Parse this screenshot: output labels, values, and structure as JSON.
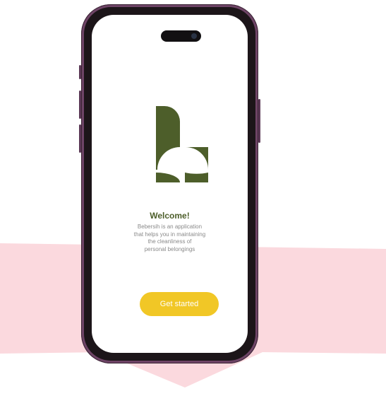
{
  "colors": {
    "backdrop_pink": "#fbd9de",
    "phone_frame": "#6e4466",
    "brand_green": "#4d5e2a",
    "accent_yellow": "#f1c726",
    "description_gray": "#8a8a8a"
  },
  "icons": {
    "logo": "bebersih-b-logo",
    "camera": "front-camera-icon"
  },
  "welcome": {
    "title": "Welcome!",
    "description_lines": [
      "Bebersih is an application",
      "that helps you in maintaining",
      "the cleanliness of",
      "personal belongings"
    ]
  },
  "actions": {
    "get_started_label": "Get started"
  }
}
